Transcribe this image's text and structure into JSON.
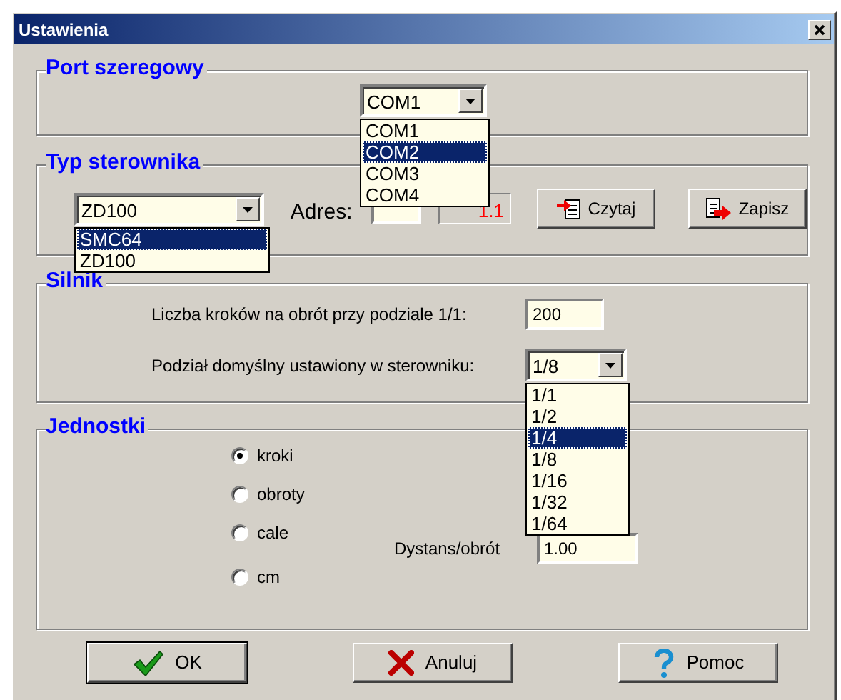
{
  "window": {
    "title": "Ustawienia"
  },
  "serial_port": {
    "title": "Port szeregowy",
    "combo": {
      "value": "COM1",
      "options": [
        {
          "label": "COM1",
          "highlighted": false
        },
        {
          "label": "COM2",
          "highlighted": true
        },
        {
          "label": "COM3",
          "highlighted": false
        },
        {
          "label": "COM4",
          "highlighted": false
        }
      ]
    }
  },
  "controller_type": {
    "title": "Typ sterownika",
    "combo": {
      "value": "ZD100",
      "options": [
        {
          "label": "SMC64",
          "highlighted": true
        },
        {
          "label": "ZD100",
          "highlighted": false
        }
      ]
    },
    "address_label": "Adres:",
    "version": "1.1",
    "buttons": [
      {
        "label": "Czytaj",
        "kind": "read"
      },
      {
        "label": "Zapisz",
        "kind": "write"
      }
    ]
  },
  "motor": {
    "title": "Silnik",
    "steps_label": "Liczba kroków na obrót przy podziale 1/1:",
    "steps_value": "200",
    "division_label": "Podział domyślny ustawiony w sterowniku:",
    "division_combo": {
      "value": "1/8",
      "options": [
        {
          "label": "1/1",
          "highlighted": false
        },
        {
          "label": "1/2",
          "highlighted": false
        },
        {
          "label": "1/4",
          "highlighted": true
        },
        {
          "label": "1/8",
          "highlighted": false
        },
        {
          "label": "1/16",
          "highlighted": false
        },
        {
          "label": "1/32",
          "highlighted": false
        },
        {
          "label": "1/64",
          "highlighted": false
        }
      ]
    }
  },
  "units": {
    "title": "Jednostki",
    "options": [
      {
        "label": "kroki",
        "selected": true
      },
      {
        "label": "obroty",
        "selected": false
      },
      {
        "label": "cale",
        "selected": false
      },
      {
        "label": "cm",
        "selected": false
      }
    ],
    "distance_label": "Dystans/obrót",
    "distance_value": "1.00"
  },
  "buttons": [
    {
      "label": "OK",
      "kind": "ok"
    },
    {
      "label": "Anuluj",
      "kind": "cancel"
    },
    {
      "label": "Pomoc",
      "kind": "help"
    }
  ]
}
